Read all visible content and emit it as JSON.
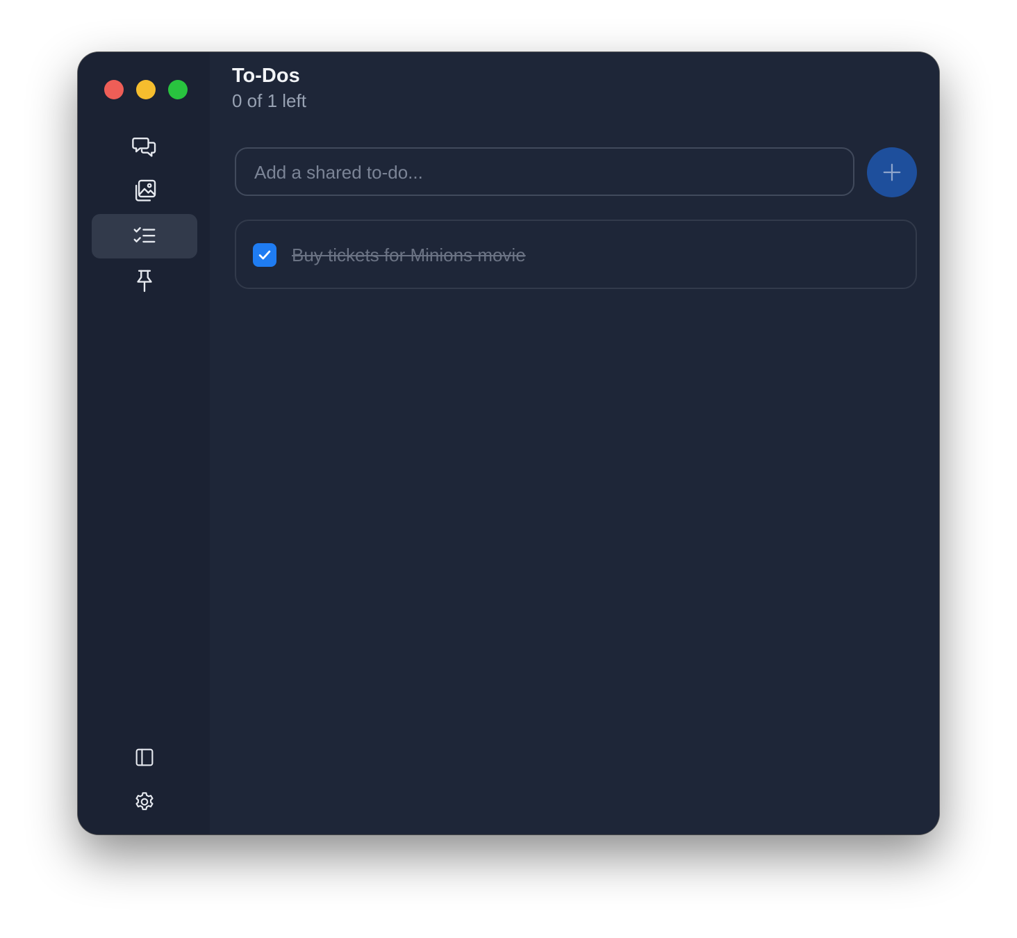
{
  "window": {
    "traffic_lights": [
      "close",
      "minimize",
      "zoom"
    ]
  },
  "sidebar": {
    "items": [
      {
        "icon": "chat-bubbles-icon",
        "active": false
      },
      {
        "icon": "photo-gallery-icon",
        "active": false
      },
      {
        "icon": "checklist-icon",
        "active": true
      },
      {
        "icon": "pin-icon",
        "active": false
      }
    ],
    "bottom_items": [
      {
        "icon": "sidebar-toggle-icon"
      },
      {
        "icon": "gear-icon"
      }
    ]
  },
  "header": {
    "title": "To-Dos",
    "subtitle": "0 of 1 left"
  },
  "new_todo": {
    "placeholder": "Add a shared to-do...",
    "value": "",
    "add_icon": "plus-icon"
  },
  "todos": [
    {
      "text": "Buy tickets for Minions movie",
      "done": true
    }
  ],
  "colors": {
    "accent": "#1f7cf2",
    "add_button": "#1e4f9c",
    "background": "#1e2638",
    "sidebar": "#1b2233"
  }
}
